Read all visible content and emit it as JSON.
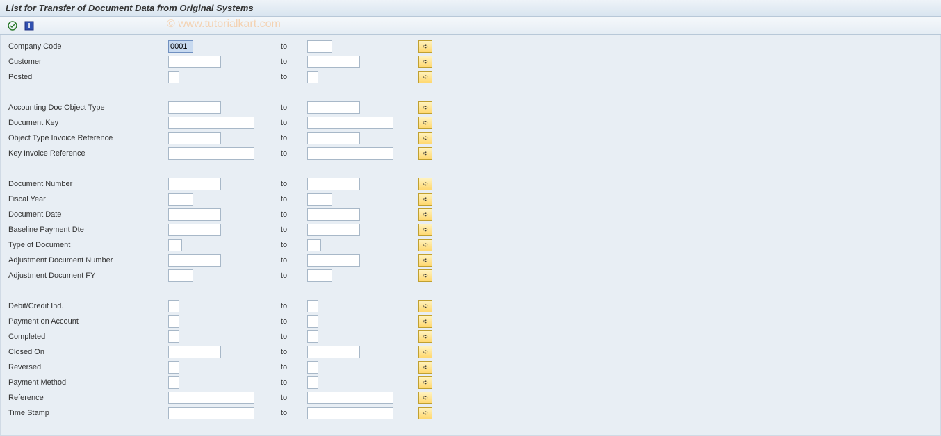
{
  "title": "List for Transfer of Document Data from Original Systems",
  "watermark": "© www.tutorialkart.com",
  "to_label": "to",
  "toolbar": {
    "execute_icon": "execute",
    "info_icon": "info"
  },
  "sections": [
    {
      "rows": [
        {
          "label": "Company Code",
          "from": "0001",
          "to": "",
          "fw": "small",
          "tw": "small",
          "selected": true
        },
        {
          "label": "Customer",
          "from": "",
          "to": "",
          "fw": "med",
          "tw": "med"
        },
        {
          "label": "Posted",
          "from": "",
          "to": "",
          "fw": "tiny",
          "tw": "tiny"
        }
      ]
    },
    {
      "rows": [
        {
          "label": "Accounting Doc Object Type",
          "from": "",
          "to": "",
          "fw": "med",
          "tw": "med"
        },
        {
          "label": "Document Key",
          "from": "",
          "to": "",
          "fw": "wide",
          "tw": "wide"
        },
        {
          "label": "Object Type Invoice Reference",
          "from": "",
          "to": "",
          "fw": "med",
          "tw": "med"
        },
        {
          "label": "Key Invoice Reference",
          "from": "",
          "to": "",
          "fw": "wide",
          "tw": "wide"
        }
      ]
    },
    {
      "rows": [
        {
          "label": "Document Number",
          "from": "",
          "to": "",
          "fw": "med",
          "tw": "med"
        },
        {
          "label": "Fiscal Year",
          "from": "",
          "to": "",
          "fw": "small",
          "tw": "small"
        },
        {
          "label": "Document Date",
          "from": "",
          "to": "",
          "fw": "med",
          "tw": "med"
        },
        {
          "label": "Baseline Payment Dte",
          "from": "",
          "to": "",
          "fw": "med",
          "tw": "med"
        },
        {
          "label": "Type of Document",
          "from": "",
          "to": "",
          "fw": "tiny2",
          "tw": "tiny2"
        },
        {
          "label": "Adjustment Document Number",
          "from": "",
          "to": "",
          "fw": "med",
          "tw": "med"
        },
        {
          "label": "Adjustment Document FY",
          "from": "",
          "to": "",
          "fw": "small",
          "tw": "small"
        }
      ]
    },
    {
      "rows": [
        {
          "label": "Debit/Credit Ind.",
          "from": "",
          "to": "",
          "fw": "tiny",
          "tw": "tiny"
        },
        {
          "label": "Payment on Account",
          "from": "",
          "to": "",
          "fw": "tiny",
          "tw": "tiny"
        },
        {
          "label": "Completed",
          "from": "",
          "to": "",
          "fw": "tiny",
          "tw": "tiny"
        },
        {
          "label": "Closed On",
          "from": "",
          "to": "",
          "fw": "med",
          "tw": "med"
        },
        {
          "label": "Reversed",
          "from": "",
          "to": "",
          "fw": "tiny",
          "tw": "tiny"
        },
        {
          "label": "Payment Method",
          "from": "",
          "to": "",
          "fw": "tiny",
          "tw": "tiny"
        },
        {
          "label": "Reference",
          "from": "",
          "to": "",
          "fw": "wide",
          "tw": "wide"
        },
        {
          "label": "Time Stamp",
          "from": "",
          "to": "",
          "fw": "wide",
          "tw": "wide"
        }
      ]
    }
  ]
}
